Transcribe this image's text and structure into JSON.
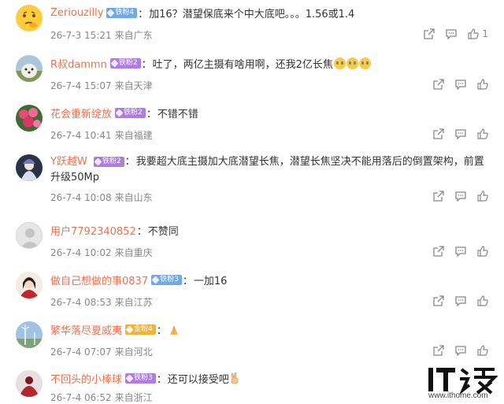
{
  "colors": {
    "username": "#eb7350",
    "meta": "#888888",
    "text": "#333333"
  },
  "comments": [
    {
      "username": "Zeriouzilly",
      "badge": "铁粉4",
      "badge_color": "blue",
      "text": "加16？潜望保底来个中大底吧。。。1.56或1.4",
      "time": "26-7-3 15:21",
      "location": "来自广东",
      "likes": "1",
      "avatar": "emoji-face"
    },
    {
      "username": "R叔dammn",
      "badge": "铁粉2",
      "badge_color": "purple",
      "text": "吐了，两亿主摄有啥用啊，还我2亿长焦",
      "time": "26-7-4 15:07",
      "location": "来自天津",
      "likes": "",
      "avatar": "dog"
    },
    {
      "username": "花会重新绽放",
      "badge": "铁粉2",
      "badge_color": "purple",
      "text": "不错不错",
      "time": "26-7-4 10:41",
      "location": "来自福建",
      "likes": "",
      "avatar": "flowers"
    },
    {
      "username": "Y跃越W",
      "badge": "铁粉2",
      "badge_color": "purple",
      "text": "我要超大底主摄加大底潜望长焦，潜望长焦坚决不能用落后的倒置架构，前置升级50Mp",
      "time": "26-7-4 10:08",
      "location": "来自山东",
      "likes": "",
      "avatar": "anime"
    },
    {
      "username": "用户7792340852",
      "badge": "",
      "badge_color": "",
      "text": "不赞同",
      "time": "26-7-4 10:02",
      "location": "来自重庆",
      "likes": "",
      "avatar": "default"
    },
    {
      "username": "做自己想做的事0837",
      "badge": "铁粉3",
      "badge_color": "blue",
      "text": "一加16",
      "time": "26-7-4 08:53",
      "location": "来自江苏",
      "likes": "",
      "avatar": "anime-red"
    },
    {
      "username": "繁华落尽夏威夷",
      "badge": "金粉4",
      "badge_color": "gold",
      "text": "",
      "time": "26-7-4 07:07",
      "location": "来自河北",
      "likes": "",
      "avatar": "landscape"
    },
    {
      "username": "不回头的小棒球",
      "badge": "铁粉3",
      "badge_color": "purple",
      "text": "还可以接受吧",
      "time": "26-7-4 06:52",
      "location": "来自浙江",
      "likes": "",
      "avatar": "red-figure"
    }
  ],
  "watermark": {
    "url": "www.ithome.com"
  },
  "icons": {
    "share": "share-icon",
    "comment": "comment-icon",
    "like": "like-icon"
  }
}
